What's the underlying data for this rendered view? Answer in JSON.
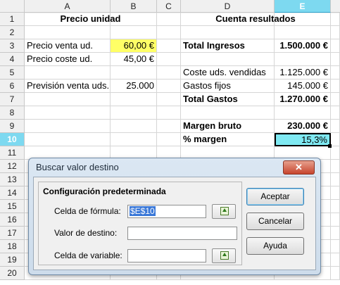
{
  "columns": [
    "A",
    "B",
    "C",
    "D",
    "E"
  ],
  "rows": [
    "1",
    "2",
    "3",
    "4",
    "5",
    "6",
    "7",
    "8",
    "9",
    "10",
    "11",
    "12",
    "13",
    "14",
    "15",
    "16",
    "17",
    "18",
    "19",
    "20"
  ],
  "cells": {
    "A1": "Precio unidad",
    "D1": "Cuenta resultados",
    "A3": "Precio venta ud.",
    "B3": "60,00 €",
    "D3": "Total Ingresos",
    "E3": "1.500.000 €",
    "A4": "Precio coste ud.",
    "B4": "45,00 €",
    "D5": "Coste uds. vendidas",
    "E5": "1.125.000 €",
    "A6": "Previsión venta uds.",
    "B6": "25.000",
    "D6": "Gastos fijos",
    "E6": "145.000 €",
    "D7": "Total Gastos",
    "E7": "1.270.000 €",
    "D9": "Margen bruto",
    "E9": "230.000 €",
    "D10": "% margen",
    "E10": "15,3%"
  },
  "colors": {
    "highlight_yellow": "#ffff66",
    "active_cell_cyan": "#7fe9f2",
    "header_selected": "#7dd9f0"
  },
  "dialog": {
    "title": "Buscar valor destino",
    "close_symbol": "✕",
    "group_title": "Configuración predeterminada",
    "formula_label": "Celda de fórmula:",
    "formula_value": "$E$10",
    "target_label": "Valor de destino:",
    "target_value": "",
    "variable_label": "Celda de variable:",
    "variable_value": "",
    "ok_label": "Aceptar",
    "cancel_label": "Cancelar",
    "help_label": "Ayuda"
  }
}
